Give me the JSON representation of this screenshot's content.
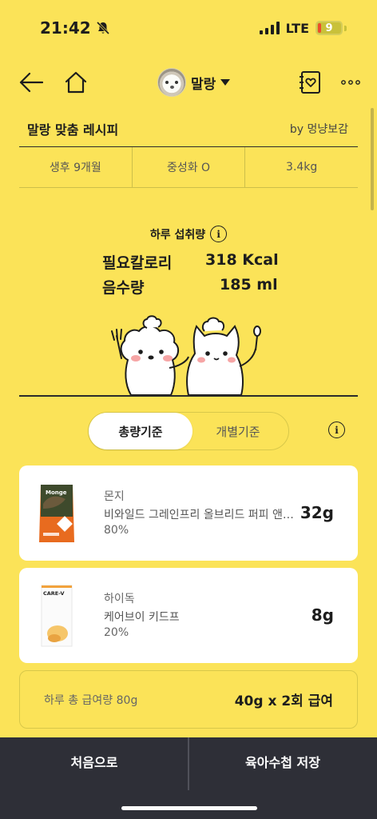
{
  "status_bar": {
    "time": "21:42",
    "network": "LTE",
    "battery": "9",
    "battery_level": 0.09
  },
  "nav": {
    "pet_name": "말랑"
  },
  "recipe": {
    "title": "말랑 맞춤 레시피",
    "by": "by 멍냥보감"
  },
  "pet_info": {
    "age": "생후 9개월",
    "neutered": "중성화 O",
    "weight": "3.4kg"
  },
  "intake": {
    "title": "하루 섭취량",
    "calorie_label": "필요칼로리",
    "calorie_value": "318 Kcal",
    "water_label": "음수량",
    "water_value": "185 ml"
  },
  "toggle": {
    "active": "총량기준",
    "inactive": "개별기준"
  },
  "foods": [
    {
      "brand": "몬지",
      "name": "비와일드 그레인프리 올브리드 퍼피 앤 주니어",
      "percent": "80%",
      "grams": "32g",
      "package_label": "Monge"
    },
    {
      "brand": "하이독",
      "name": "케어브이 키드프",
      "percent": "20%",
      "grams": "8g",
      "package_label": "CARE-V"
    }
  ],
  "total": {
    "label": "하루 총 급여량 80g",
    "value": "40g x 2회 급여"
  },
  "bottom": {
    "left": "처음으로",
    "right": "육아수첩 저장"
  },
  "colors": {
    "background": "#FBE358",
    "bottom_bar": "#2E2F37",
    "card": "#FFFFFF"
  }
}
